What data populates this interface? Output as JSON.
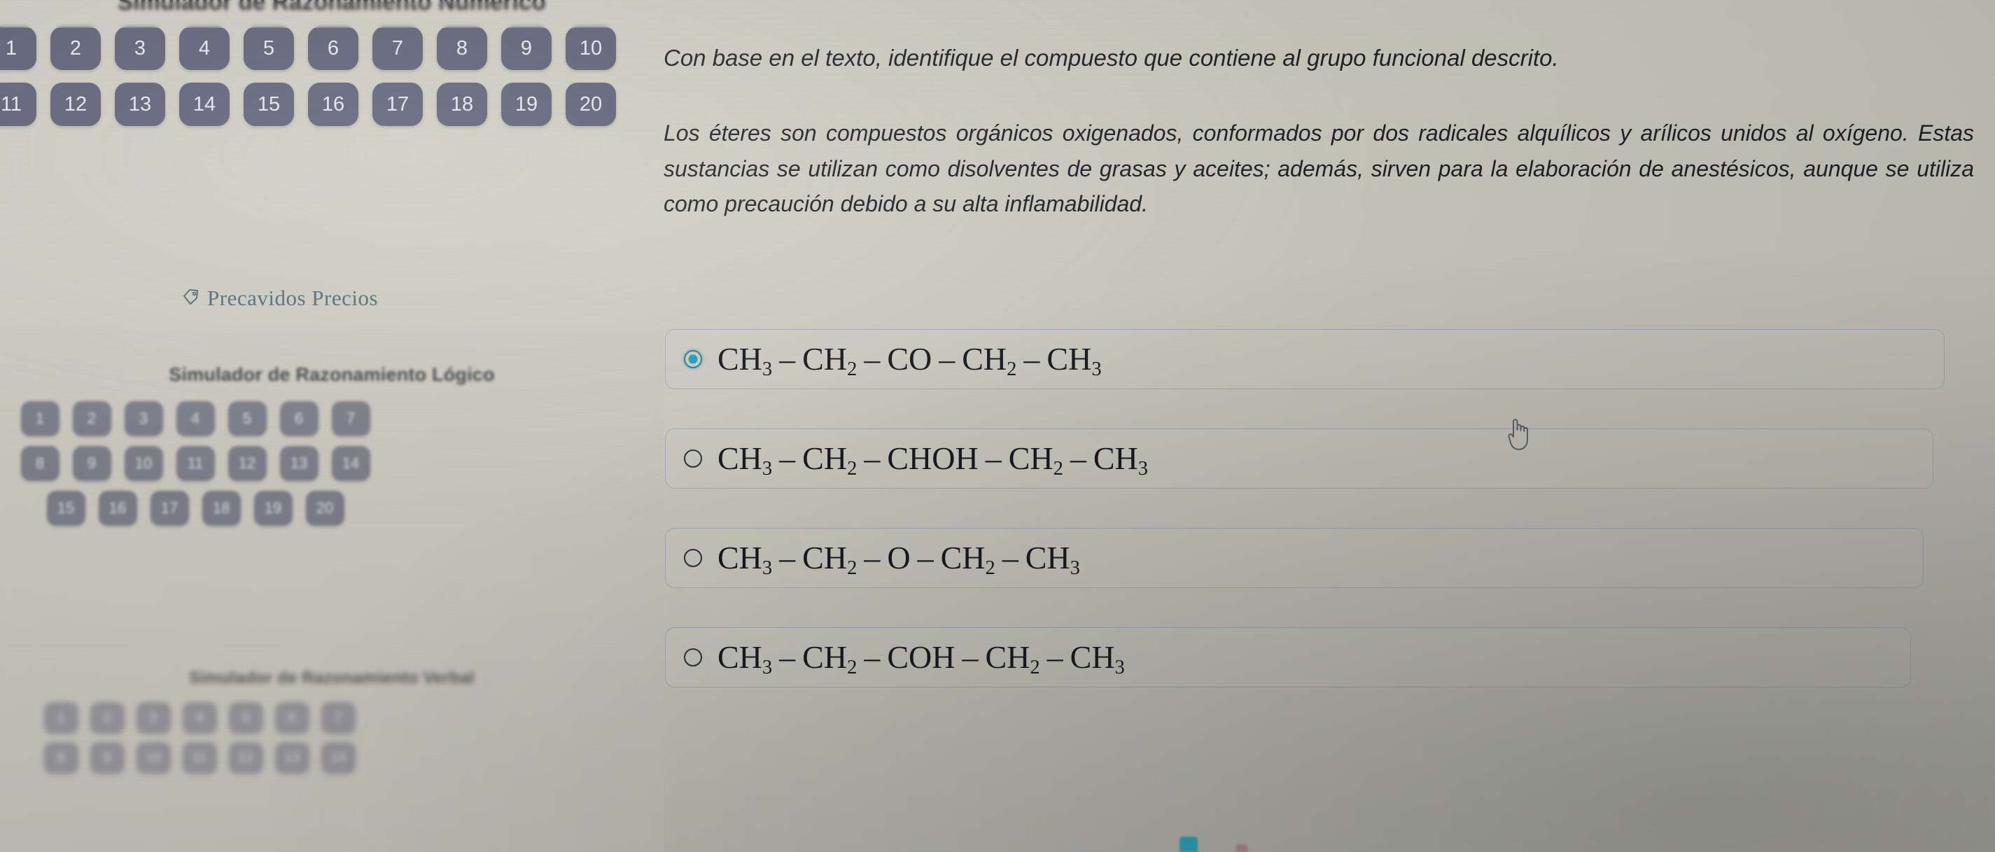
{
  "left_panel": {
    "sections": [
      {
        "title": "Simulador de Razonamiento Numérico",
        "numbers": [
          "1",
          "2",
          "3",
          "4",
          "5",
          "6",
          "7",
          "8",
          "9",
          "10",
          "11",
          "12",
          "13",
          "14",
          "15",
          "16",
          "17",
          "18",
          "19",
          "20"
        ]
      },
      {
        "title": "Simulador de Razonamiento Lógico",
        "numbers": [
          "1",
          "2",
          "3",
          "4",
          "5",
          "6",
          "7",
          "8",
          "9",
          "10",
          "11",
          "12",
          "13",
          "14",
          "15",
          "16",
          "17",
          "18",
          "19",
          "20"
        ]
      },
      {
        "title": "Simulador de Razonamiento Verbal",
        "numbers": [
          "1",
          "2",
          "3",
          "4",
          "5",
          "6",
          "7",
          "8",
          "9",
          "10",
          "11",
          "12",
          "13",
          "14"
        ]
      }
    ],
    "brand": {
      "name": "Precavidos Precios",
      "icon": "price-tag-icon",
      "color": "#4f6e73"
    }
  },
  "main": {
    "question_prompt": "Con base en el texto, identifique el compuesto que contiene al grupo funcional descrito.",
    "passage": "Los éteres son compuestos orgánicos oxigenados, conformados por dos radicales alquílicos y arílicos unidos al oxígeno. Estas sustancias se utilizan como disolventes de grasas y aceites; además, sirven para la elaboración de anestésicos, aunque se utiliza como precaución debido a su alta inflamabilidad.",
    "options": [
      {
        "id": "option-a",
        "selected": true,
        "formula_text": "CH3 – CH2 – CO – CH2 – CH3",
        "parts": [
          "CH",
          "3",
          " – ",
          "CH",
          "2",
          " – ",
          "CO",
          " – ",
          "CH",
          "2",
          " – ",
          "CH",
          "3"
        ]
      },
      {
        "id": "option-b",
        "selected": false,
        "formula_text": "CH3 – CH2 – CHOH – CH2 – CH3",
        "parts": [
          "CH",
          "3",
          " – ",
          "CH",
          "2",
          " – ",
          "CHOH",
          " – ",
          "CH",
          "2",
          " – ",
          "CH",
          "3"
        ]
      },
      {
        "id": "option-c",
        "selected": false,
        "formula_text": "CH3 – CH2 – O – CH2 – CH3",
        "parts": [
          "CH",
          "3",
          " – ",
          "CH",
          "2",
          " – ",
          "O",
          " – ",
          "CH",
          "2",
          " – ",
          "CH",
          "3"
        ]
      },
      {
        "id": "option-d",
        "selected": false,
        "formula_text": "CH3 – CH2 – COH – CH2 – CH3",
        "parts": [
          "CH",
          "3",
          " – ",
          "CH",
          "2",
          " – ",
          "COH",
          " – ",
          "CH",
          "2",
          " – ",
          "CH",
          "3"
        ]
      }
    ],
    "cursor": "pointer-hand-cursor"
  },
  "colors": {
    "background": "#c4c3b8",
    "number_button": "#5c5f77",
    "number_button_text": "#e9e9f2",
    "text": "#1d2024",
    "accent_teal": "#12a4c6",
    "brand_teal": "#4f6e73",
    "card_border": "#8084a0"
  }
}
